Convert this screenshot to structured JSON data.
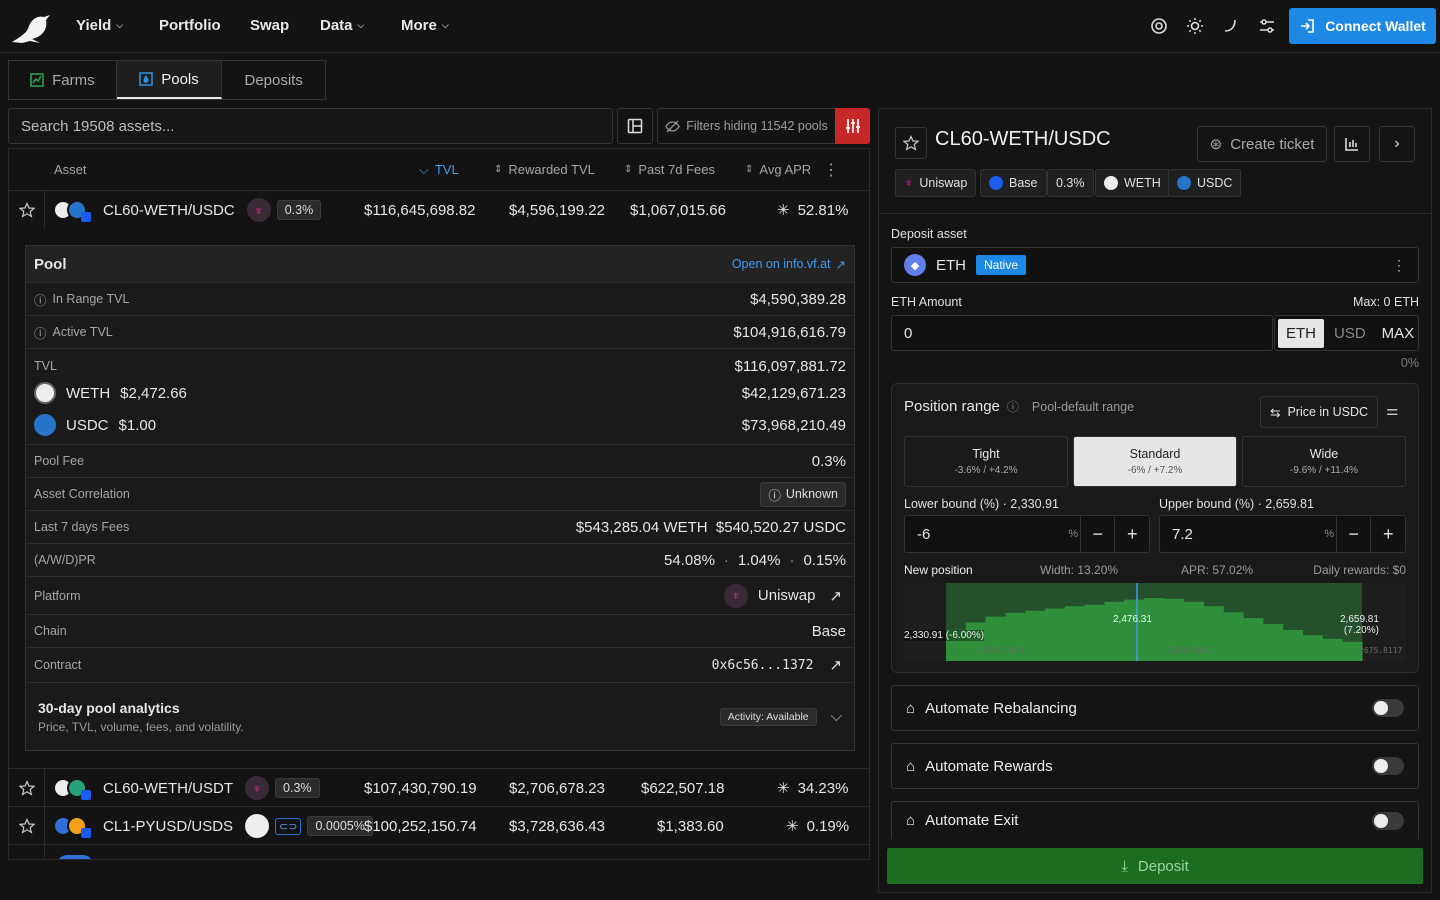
{
  "nav": {
    "items": [
      "Yield",
      "Portfolio",
      "Swap",
      "Data",
      "More"
    ],
    "connect": "Connect Wallet"
  },
  "tabs": [
    "Farms",
    "Pools",
    "Deposits"
  ],
  "search": {
    "placeholder": "Search 19508 assets...",
    "filters": "Filters hiding 11542 pools"
  },
  "table": {
    "headers": [
      "Asset",
      "TVL",
      "Rewarded TVL",
      "Past 7d Fees",
      "Avg APR"
    ],
    "rows": [
      {
        "name": "CL60-WETH/USDC",
        "fee": "0.3%",
        "tvl": "$116,645,698.82",
        "rtvl": "$4,596,199.22",
        "fees": "$1,067,015.66",
        "apr": "52.81%"
      },
      {
        "name": "CL60-WETH/USDT",
        "fee": "0.3%",
        "tvl": "$107,430,790.19",
        "rtvl": "$2,706,678.23",
        "fees": "$622,507.18",
        "apr": "34.23%"
      },
      {
        "name": "CL1-PYUSD/USDS",
        "fee": "0.0005%",
        "tvl": "$100,252,150.74",
        "rtvl": "$3,728,636.43",
        "fees": "$1,383.60",
        "apr": "0.19%"
      }
    ]
  },
  "pool": {
    "title": "Pool",
    "link": "Open on info.vf.at",
    "in_range_label": "In Range TVL",
    "in_range": "$4,590,389.28",
    "active_label": "Active TVL",
    "active": "$104,916,616.79",
    "tvl_label": "TVL",
    "tvl": "$116,097,881.72",
    "weth_label": "WETH",
    "weth_price": "$2,472.66",
    "weth_tvl": "$42,129,671.23",
    "usdc_label": "USDC",
    "usdc_price": "$1.00",
    "usdc_tvl": "$73,968,210.49",
    "fee_label": "Pool Fee",
    "fee": "0.3%",
    "corr_label": "Asset Correlation",
    "corr": "Unknown",
    "fees7_label": "Last 7 days Fees",
    "fees7": "$543,285.04 WETH  $540,520.27 USDC",
    "pr_label": "(A/W/D)PR",
    "pr_a": "54.08%",
    "pr_w": "1.04%",
    "pr_d": "0.15%",
    "platform_label": "Platform",
    "platform": "Uniswap",
    "chain_label": "Chain",
    "chain": "Base",
    "contract_label": "Contract",
    "contract": "0x6c56...1372",
    "analytics_title": "30-day pool analytics",
    "analytics_sub": "Price, TVL, volume, fees, and volatility.",
    "activity": "Activity: Available"
  },
  "right": {
    "title": "CL60-WETH/USDC",
    "create": "Create ticket",
    "chips": [
      "Uniswap",
      "Base",
      "0.3%",
      "WETH",
      "USDC"
    ],
    "deposit_label": "Deposit asset",
    "asset": "ETH",
    "native": "Native",
    "amount_label": "ETH Amount",
    "max_label": "Max: 0 ETH",
    "amount": "0",
    "units": [
      "ETH",
      "USD",
      "MAX"
    ],
    "pct": "0%",
    "range_title": "Position range",
    "range_sub": "Pool-default range",
    "price_in": "Price in USDC",
    "ranges": [
      {
        "name": "Tight",
        "val": "-3.6% / +4.2%"
      },
      {
        "name": "Standard",
        "val": "-6% / +7.2%"
      },
      {
        "name": "Wide",
        "val": "-9.6% / +11.4%"
      }
    ],
    "lower_label": "Lower bound (%) · 2,330.91",
    "upper_label": "Upper bound (%) · 2,659.81",
    "lower": "-6",
    "upper": "7.2",
    "pct_sym": "%",
    "newpos": "New position",
    "width": "Width: 13.20%",
    "apr": "APR: 57.02%",
    "daily": "Daily rewards: $0",
    "lo_tag": "2,330.91 (-6.00%)",
    "mid_tag": "2,476.31",
    "hi_tag1": "2,659.81",
    "hi_tag2": "(7.20%)",
    "ax1": "2373.2463",
    "ax2": "2510.9021",
    "ax3": "2675.8117",
    "automate": [
      "Automate Rebalancing",
      "Automate Rewards",
      "Automate Exit"
    ],
    "deposit_btn": "Deposit"
  },
  "chart_data": {
    "type": "bar",
    "values": [
      0.42,
      0.52,
      0.6,
      0.65,
      0.68,
      0.71,
      0.74,
      0.76,
      0.8,
      0.83,
      0.85,
      0.84,
      0.8,
      0.74,
      0.66,
      0.58,
      0.5,
      0.42,
      0.35,
      0.3,
      0.26
    ]
  }
}
